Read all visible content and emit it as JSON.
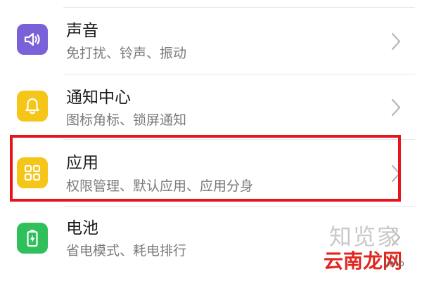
{
  "settings": {
    "items": [
      {
        "title": "声音",
        "subtitle": "免打扰、铃声、振动",
        "icon": "speaker-icon",
        "icon_color": "#7b61d8"
      },
      {
        "title": "通知中心",
        "subtitle": "图标角标、锁屏通知",
        "icon": "bell-icon",
        "icon_color": "#f5c518"
      },
      {
        "title": "应用",
        "subtitle": "权限管理、默认应用、应用分身",
        "icon": "grid-icon",
        "icon_color": "#f5c518",
        "highlighted": true
      },
      {
        "title": "电池",
        "subtitle": "省电模式、耗电排行",
        "icon": "battery-icon",
        "icon_color": "#2fbf5b"
      }
    ]
  },
  "highlight": {
    "color": "#e8141b"
  },
  "watermark": {
    "top_text": "知览家",
    "bottom_text": "云南龙网",
    "small_text": "ynlo"
  }
}
